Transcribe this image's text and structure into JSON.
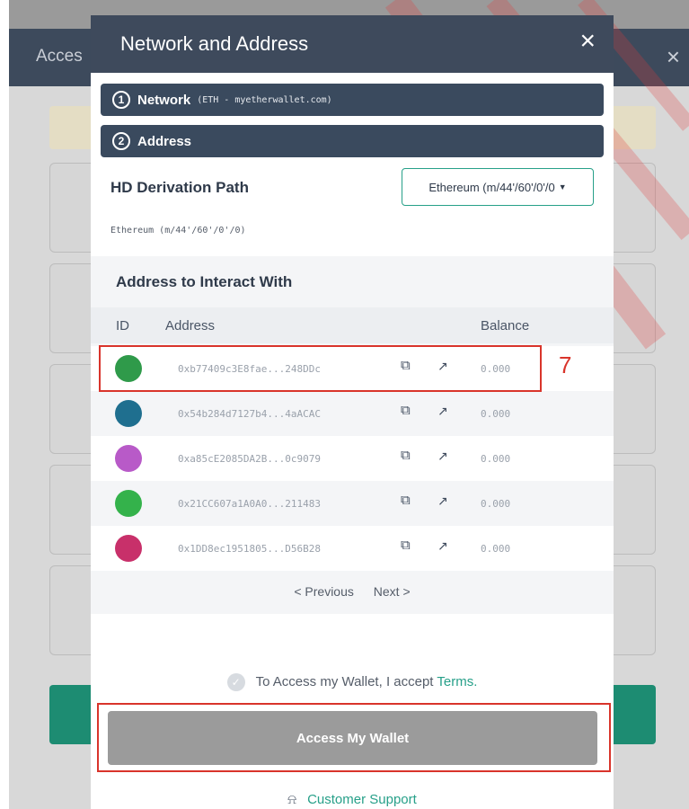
{
  "background": {
    "header_title": "Acces",
    "close_symbol": "×"
  },
  "modal": {
    "title": "Network and Address",
    "close_symbol": "×"
  },
  "steps": [
    {
      "number": "1",
      "label": "Network",
      "sub": "(ETH - myetherwallet.com)"
    },
    {
      "number": "2",
      "label": "Address",
      "sub": ""
    }
  ],
  "hd": {
    "title": "HD Derivation Path",
    "selected": "Ethereum (m/44'/60'/0'/0",
    "path": "Ethereum (m/44'/60'/0'/0)"
  },
  "addresses": {
    "title": "Address to Interact With",
    "columns": [
      "ID",
      "Address",
      "Balance"
    ],
    "rows": [
      {
        "address": "0xb77409c3E8fae...248DDc",
        "balance": "0.000",
        "avatar_color": "#2f9a4a"
      },
      {
        "address": "0x54b284d7127b4...4aACAC",
        "balance": "0.000",
        "avatar_color": "#1f6f8f"
      },
      {
        "address": "0xa85cE2085DA2B...0c9079",
        "balance": "0.000",
        "avatar_color": "#b85ac8"
      },
      {
        "address": "0x21CC607a1A0A0...211483",
        "balance": "0.000",
        "avatar_color": "#34b24b"
      },
      {
        "address": "0x1DD8ec1951805...D56B28",
        "balance": "0.000",
        "avatar_color": "#c8306a"
      }
    ]
  },
  "pager": {
    "previous": "< Previous",
    "next": "Next >"
  },
  "terms": {
    "text": "To Access my Wallet, I accept ",
    "link": "Terms."
  },
  "access_button": "Access My Wallet",
  "support": "Customer Support",
  "annotation": {
    "label": "7",
    "color": "#d9342b"
  },
  "colors": {
    "header_bg": "#3e4a5c",
    "accent": "#27a089",
    "button_disabled": "#9b9b9b"
  },
  "icons": {
    "copy": "copy-icon",
    "external": "external-link-icon",
    "support": "support-bell-icon",
    "check": "check-icon"
  }
}
